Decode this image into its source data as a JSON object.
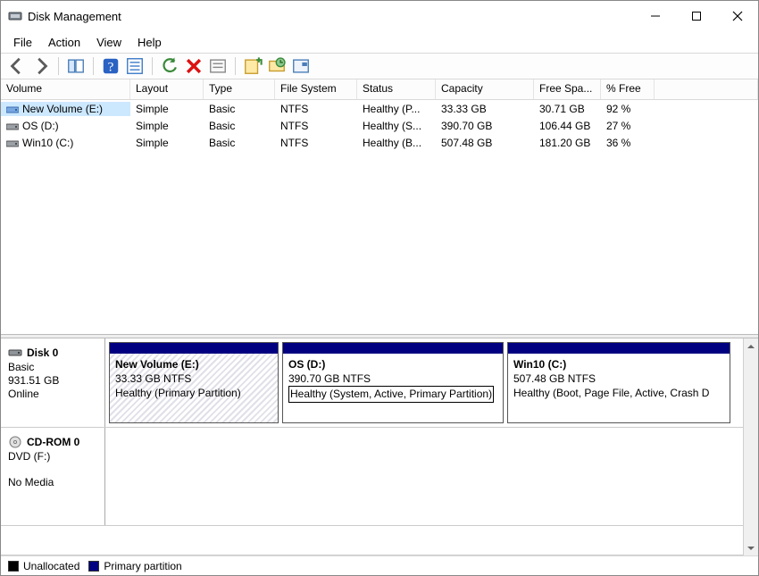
{
  "titlebar": {
    "title": "Disk Management"
  },
  "menu": {
    "file": "File",
    "action": "Action",
    "view": "View",
    "help": "Help"
  },
  "toolbar_icons": {
    "back": "back-arrow-icon",
    "forward": "forward-arrow-icon",
    "console": "show-hide-console-icon",
    "help": "help-icon",
    "properties": "properties-icon",
    "add": "add-icon",
    "delete": "delete-icon",
    "format": "format-icon",
    "new_volume": "new-volume-icon",
    "rescan": "rescan-icon",
    "eject": "eject-icon"
  },
  "columns": {
    "volume": "Volume",
    "layout": "Layout",
    "type": "Type",
    "filesystem": "File System",
    "status": "Status",
    "capacity": "Capacity",
    "free": "Free Spa...",
    "percent": "% Free"
  },
  "volumes": [
    {
      "name": "New Volume (E:)",
      "layout": "Simple",
      "type": "Basic",
      "fs": "NTFS",
      "status": "Healthy (P...",
      "capacity": "33.33 GB",
      "free": "30.71 GB",
      "percent": "92 %",
      "icon": "blue"
    },
    {
      "name": "OS (D:)",
      "layout": "Simple",
      "type": "Basic",
      "fs": "NTFS",
      "status": "Healthy (S...",
      "capacity": "390.70 GB",
      "free": "106.44 GB",
      "percent": "27 %",
      "icon": "dark"
    },
    {
      "name": "Win10 (C:)",
      "layout": "Simple",
      "type": "Basic",
      "fs": "NTFS",
      "status": "Healthy (B...",
      "capacity": "507.48 GB",
      "free": "181.20 GB",
      "percent": "36 %",
      "icon": "dark"
    }
  ],
  "disks": [
    {
      "title": "Disk 0",
      "kind": "Basic",
      "size": "931.51 GB",
      "state": "Online",
      "icon": "hdd",
      "parts": [
        {
          "name": "New Volume  (E:)",
          "sub": "33.33 GB NTFS",
          "status": "Healthy (Primary Partition)",
          "hatched": true,
          "status_boxed": false
        },
        {
          "name": "OS  (D:)",
          "sub": "390.70 GB NTFS",
          "status": "Healthy (System, Active, Primary Partition)",
          "hatched": false,
          "status_boxed": true
        },
        {
          "name": "Win10  (C:)",
          "sub": "507.48 GB NTFS",
          "status": "Healthy (Boot, Page File, Active, Crash D",
          "hatched": false,
          "status_boxed": false
        }
      ]
    },
    {
      "title": "CD-ROM 0",
      "kind": "DVD (F:)",
      "size": "",
      "state": "No Media",
      "icon": "cd",
      "parts": []
    }
  ],
  "legend": {
    "unallocated": "Unallocated",
    "primary": "Primary partition"
  }
}
